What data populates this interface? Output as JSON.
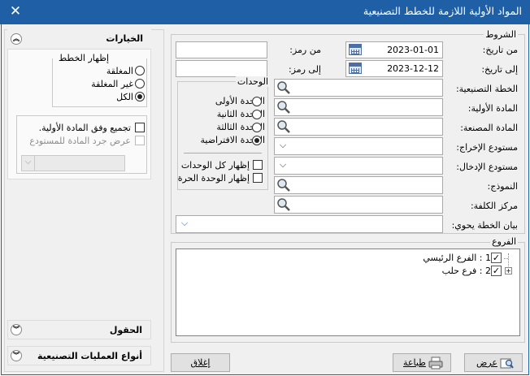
{
  "window": {
    "title": "المواد الأولية اللازمة للخطط التصنيعية",
    "close_glyph": "✕"
  },
  "conditions": {
    "legend": "الشروط",
    "from_date_label": "من تاريخ:",
    "from_date": "2023-01-01",
    "to_date_label": "إلى تاريخ:",
    "to_date": "2023-12-12",
    "from_code_label": "من رمز:",
    "from_code": "",
    "to_code_label": "إلى رمز:",
    "to_code": "",
    "plan_label": "الخطة التصنيعية:",
    "raw_material_label": "المادة الأولية:",
    "product_label": "المادة المصنعة:",
    "out_wh_label": "مستودع الإخراج:",
    "in_wh_label": "مستودع الإدخال:",
    "form_label": "النموذج:",
    "cost_center_label": "مركز الكلفة:",
    "plan_stmt_label": "بيان الخطة يحوي:"
  },
  "units": {
    "legend": "الوحدات",
    "options": [
      "الوحدة الأولى",
      "الوحدة الثانية",
      "الوحدة الثالثة",
      "الوحدة الافتراضية"
    ],
    "selected": 3,
    "show_all": "إظهار كل الوحدات",
    "show_free": "إظهار الوحدة الحرة"
  },
  "branches": {
    "legend": "الفروع",
    "items": [
      {
        "label": "1 : الفرع الرئيسي",
        "checked": true
      },
      {
        "label": "2 : فرع حلب",
        "checked": true
      }
    ]
  },
  "options_panel": {
    "title": "الخيارات",
    "show_plans_legend": "إظهار الخطط",
    "plan_options": [
      "المغلقة",
      "غير المغلقة",
      "الكل"
    ],
    "plan_selected": 2,
    "group_by_material": "تجميع وفق المادة الأولية.",
    "show_inventory": "عرض جرد المادة للمستودع"
  },
  "fields_panel": {
    "title": "الحقول"
  },
  "ops_panel": {
    "title": "أنواع العمليات التصنيعية"
  },
  "buttons": {
    "view": "عرض",
    "print": "طباعة",
    "close": "إغلاق"
  },
  "icons": {
    "collapse": "double-chevron-up-icon",
    "expand": "double-chevron-down-icon",
    "lookup": "magnifier-icon",
    "calendar": "calendar-icon"
  }
}
